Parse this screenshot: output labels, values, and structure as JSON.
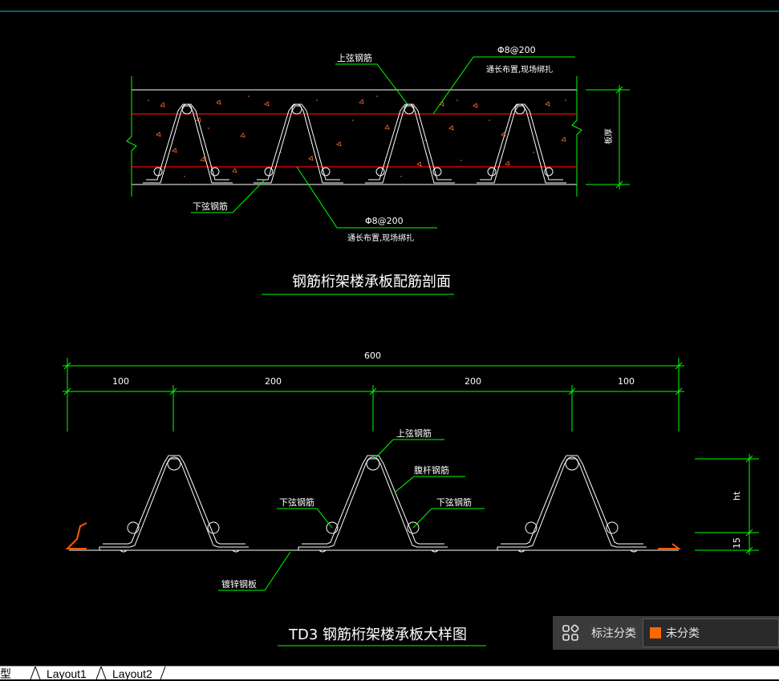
{
  "drawing": {
    "upper_title": "钢筋桁架楼承板配筋剖面",
    "lower_title": "TD3 钢筋桁架楼承板大样图",
    "upper_labels": {
      "top_chord": "上弦钢筋",
      "bottom_chord": "下弦钢筋",
      "rebar_top_spec": "Φ8@200",
      "rebar_top_note": "通长布置,现场绑扎",
      "rebar_bottom_spec": "Φ8@200",
      "rebar_bottom_note": "通长布置,现场绑扎",
      "thickness": "板厚"
    },
    "lower_labels": {
      "top_chord": "上弦钢筋",
      "web": "腹杆钢筋",
      "bottom_left": "下弦钢筋",
      "bottom_right": "下弦钢筋",
      "deck": "镀锌钢板",
      "height": "ht",
      "base": "15"
    },
    "dimensions": {
      "total": "600",
      "seg1": "100",
      "seg2": "200",
      "seg3": "200",
      "seg4": "100"
    },
    "colors": {
      "background": "#000000",
      "dimension_green": "#00ff00",
      "rebar_red": "#ff0000",
      "concrete_marks": "#ff6a30",
      "outline_white": "#ffffff"
    }
  },
  "panel": {
    "icon": "grid-icon",
    "label": "标注分类",
    "selected": "未分类",
    "swatch_color": "#ff6600"
  },
  "tabs": {
    "model": "模型",
    "layout1": "Layout1",
    "layout2": "Layout2"
  }
}
